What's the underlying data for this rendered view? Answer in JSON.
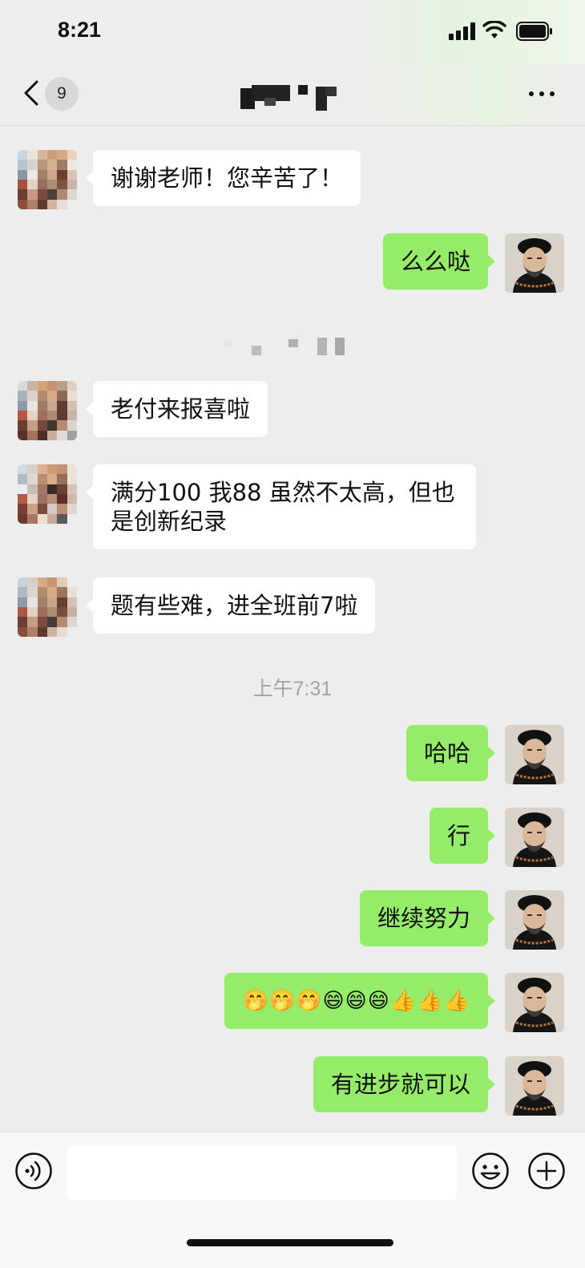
{
  "status_bar": {
    "time": "8:21"
  },
  "nav": {
    "unread_count": "9",
    "title": ""
  },
  "messages": {
    "m1": "谢谢老师！您辛苦了！",
    "m2": "么么哒",
    "m3": "老付来报喜啦",
    "m4": "满分100 我88 虽然不太高，但也是创新纪录",
    "m5": "题有些难，进全班前7啦",
    "ts": "上午7:31",
    "m6": "哈哈",
    "m7": "行",
    "m8": "继续努力",
    "m9": "🤭🤭🤭😄😄😄👍👍👍",
    "m10": "有进步就可以"
  },
  "colors": {
    "outgoing_bubble": "#95ec69",
    "incoming_bubble": "#ffffff",
    "chat_background": "#ededed"
  },
  "icons": {
    "nav": [
      "back-chevron-icon",
      "more-icon"
    ],
    "input": [
      "voice-icon",
      "emoji-icon",
      "plus-icon"
    ]
  }
}
